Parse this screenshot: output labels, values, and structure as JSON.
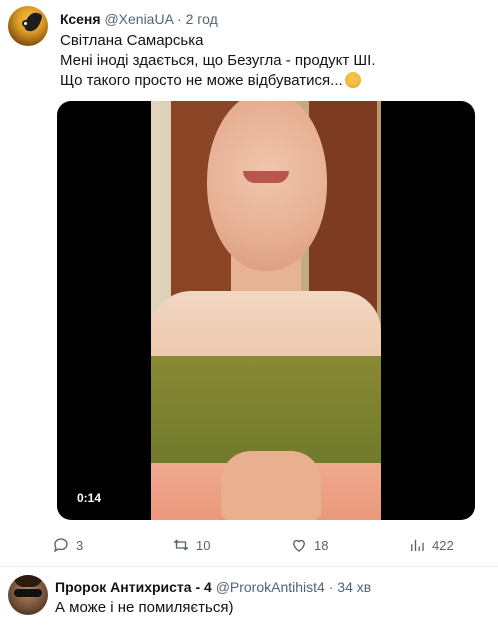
{
  "tweet": {
    "author_name": "Ксеня",
    "author_handle": "@XeniaUA",
    "separator": "·",
    "time": "2 год",
    "lines": [
      "Світлана Самарська",
      "Мені іноді здається, що Безугла - продукт ШІ.",
      "Що такого просто не може відбуватися..."
    ],
    "emoji": "woman-facepalming-emoji",
    "video": {
      "timecode": "0:14"
    },
    "actions": {
      "replies": "3",
      "retweets": "10",
      "likes": "18",
      "views": "422"
    }
  },
  "reply": {
    "author_name": "Пророк Антихриста - 4",
    "author_handle": "@ProrokAntihist4",
    "separator": "·",
    "time": "34 хв",
    "text": "А може і не помиляється)"
  },
  "colors": {
    "text": "#0f1419",
    "secondary": "#536471",
    "media_bg": "#000000"
  }
}
